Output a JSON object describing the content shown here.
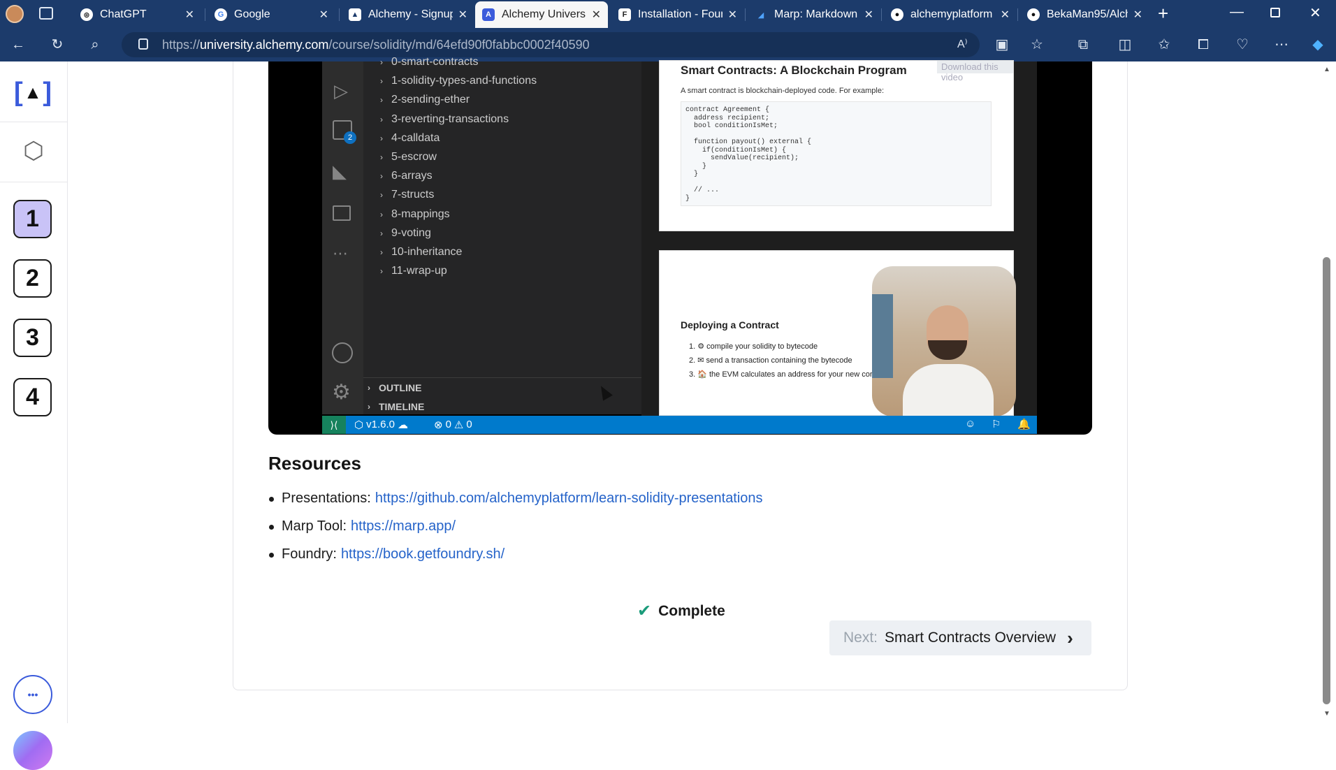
{
  "browser": {
    "tabs": [
      {
        "title": "ChatGPT",
        "icon": "chatgpt-icon"
      },
      {
        "title": "Google",
        "icon": "google-icon"
      },
      {
        "title": "Alchemy - Signup",
        "icon": "alchemy-icon"
      },
      {
        "title": "Alchemy University",
        "icon": "alchemy-university-icon"
      },
      {
        "title": "Installation - Foundry",
        "icon": "foundry-icon"
      },
      {
        "title": "Marp: Markdown",
        "icon": "marp-icon"
      },
      {
        "title": "alchemyplatform",
        "icon": "github-icon"
      },
      {
        "title": "BekaMan95/Alch",
        "icon": "github-icon"
      }
    ],
    "url_prefix": "https://",
    "url_host": "university.alchemy.com",
    "url_path": "/course/solidity/md/64efd90f0fabbc0002f40590"
  },
  "rail": {
    "items": [
      "1",
      "2",
      "3",
      "4"
    ],
    "more_label": "•••"
  },
  "video": {
    "explorer_items": [
      "0-smart-contracts",
      "1-solidity-types-and-functions",
      "2-sending-ether",
      "3-reverting-transactions",
      "4-calldata",
      "5-escrow",
      "6-arrays",
      "7-structs",
      "8-mappings",
      "9-voting",
      "10-inheritance",
      "11-wrap-up"
    ],
    "outline_label": "OUTLINE",
    "timeline_label": "TIMELINE",
    "extensions_badge": "2",
    "status_version": "v1.6.0",
    "status_errors": "0",
    "status_warnings": "0",
    "slide1": {
      "title": "Smart Contracts: A Blockchain Program",
      "subtitle": "A smart contract is blockchain-deployed code. For example:",
      "download_label": "Download this video",
      "code": "contract Agreement {\n  address recipient;\n  bool conditionIsMet;\n\n  function payout() external {\n    if(conditionIsMet) {\n      sendValue(recipient);\n    }\n  }\n\n  // ...\n}"
    },
    "slide2": {
      "title": "Deploying a Contract",
      "steps": [
        "⚙ compile your solidity to bytecode",
        "✉ send a transaction containing the bytecode",
        "🏠 the EVM calculates an address for your new cor"
      ]
    }
  },
  "resources": {
    "heading": "Resources",
    "items": [
      {
        "label": "Presentations:",
        "link": "https://github.com/alchemyplatform/learn-solidity-presentations"
      },
      {
        "label": "Marp Tool:",
        "link": "https://marp.app/"
      },
      {
        "label": "Foundry:",
        "link": "https://book.getfoundry.sh/"
      }
    ]
  },
  "complete_label": "Complete",
  "next": {
    "prefix": "Next:",
    "title": "Smart Contracts Overview"
  },
  "colors": {
    "brand": "#3b5bdb",
    "link": "#2563c9",
    "selected": "#c9c3f7",
    "vscode_blue": "#007acc"
  }
}
